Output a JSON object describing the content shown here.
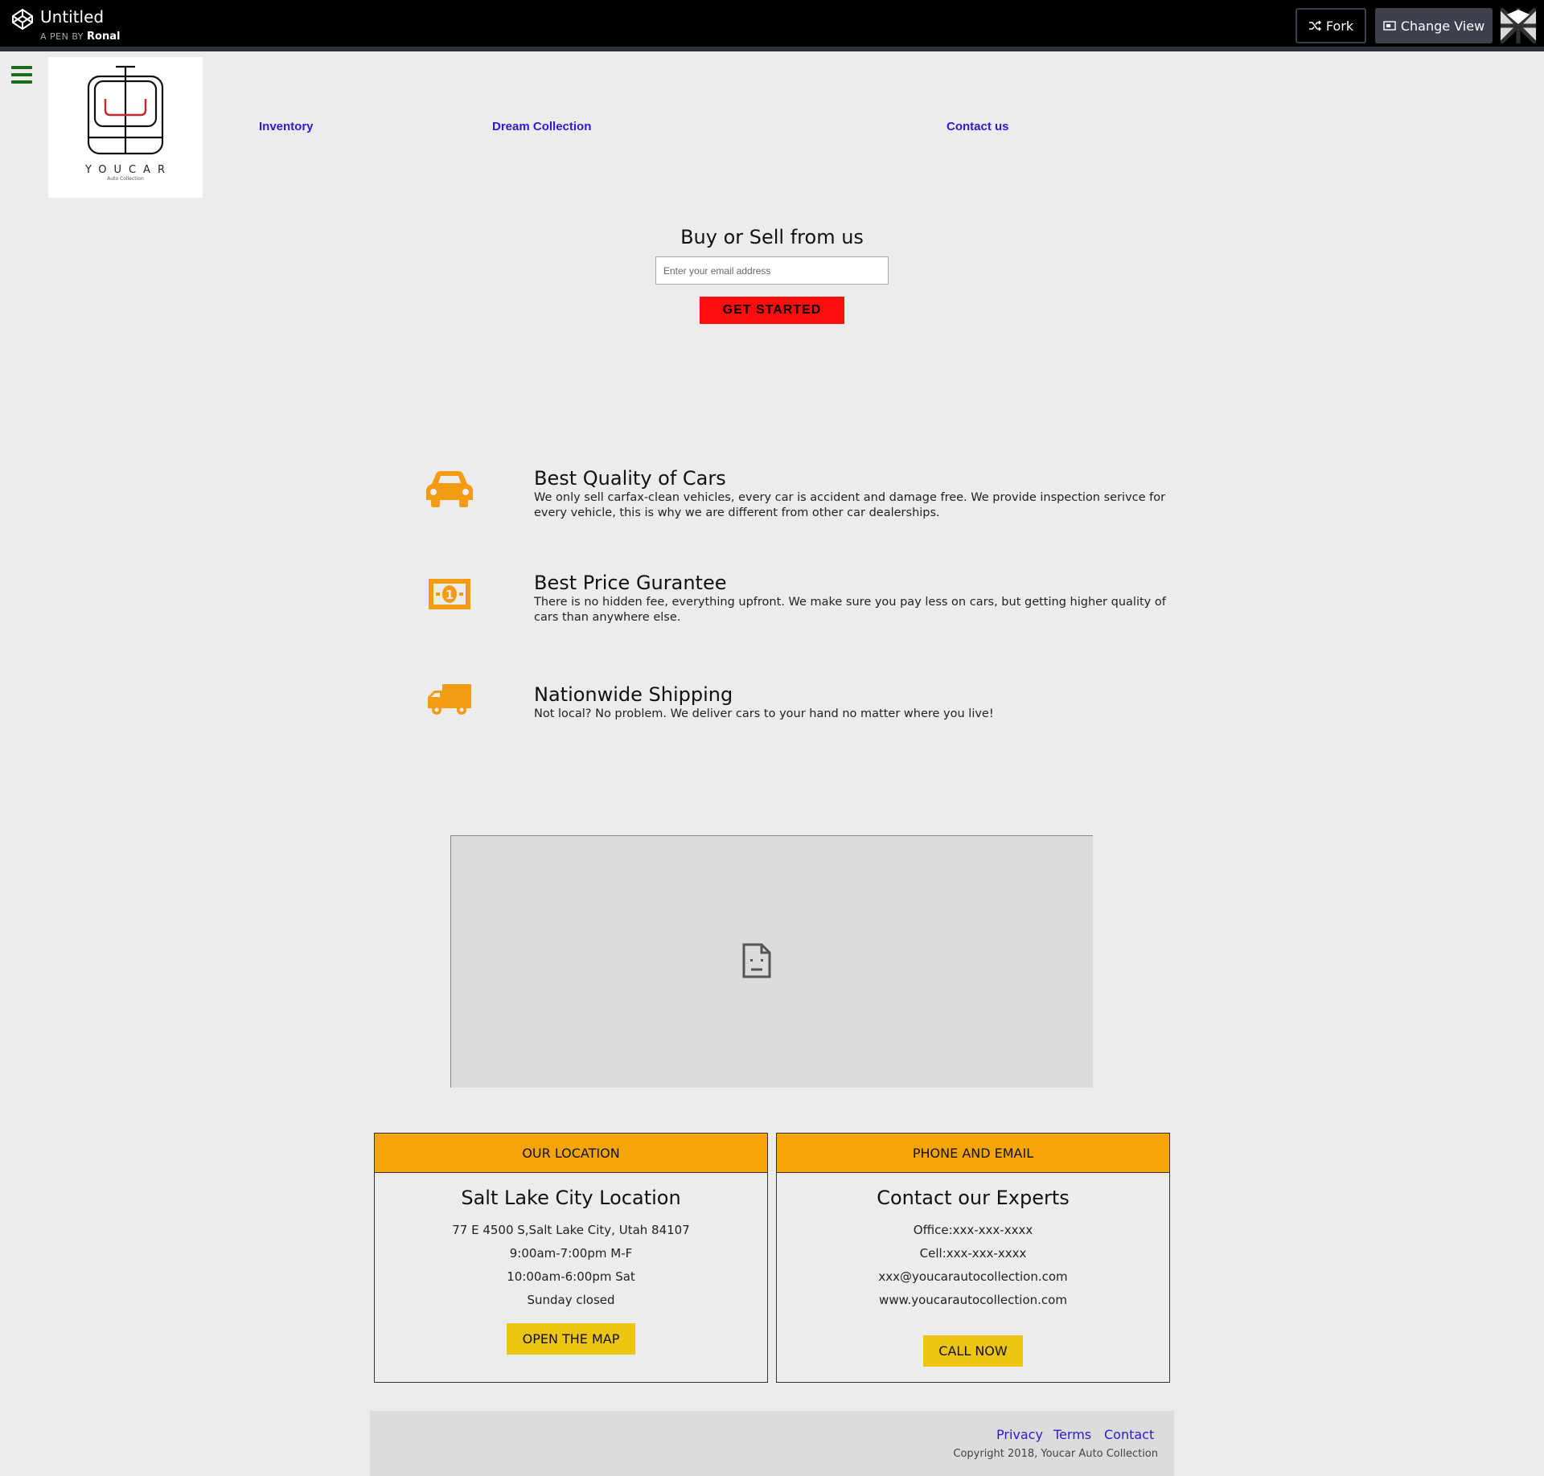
{
  "codepen": {
    "title": "Untitled",
    "byline_prefix": "A PEN BY",
    "author": "Ronal",
    "fork_label": "Fork",
    "change_view_label": "Change View"
  },
  "brand": {
    "name": "YOUCAR",
    "tagline": "Auto Collection",
    "accent_color": "#c0282d"
  },
  "nav": {
    "items": [
      {
        "label": "Inventory"
      },
      {
        "label": "Dream Collection"
      },
      {
        "label": "Contact us"
      }
    ],
    "link_color": "#2a1bd0"
  },
  "hero": {
    "title": "Buy or Sell from us",
    "email_placeholder": "Enter your email address",
    "cta_label": "GET STARTED",
    "cta_color": "#ff0d0d"
  },
  "features": [
    {
      "icon": "car-icon",
      "title": "Best Quality of Cars",
      "text": "We only sell carfax-clean vehicles, every car is accident and damage free. We provide inspection serivce for every vehicle, this is why we are different from other car dealerships."
    },
    {
      "icon": "money-icon",
      "title": "Best Price Gurantee",
      "text": "There is no hidden fee, everything upfront. We make sure you pay less on cars, but getting higher quality of cars than anywhere else."
    },
    {
      "icon": "truck-icon",
      "title": "Nationwide Shipping",
      "text": "Not local? No problem. We deliver cars to your hand no matter where you live!"
    }
  ],
  "feature_icon_color": "#f39c12",
  "location_card": {
    "header": "OUR LOCATION",
    "title": "Salt Lake City Location",
    "lines": [
      "77 E 4500 S,Salt Lake City, Utah 84107",
      "9:00am-7:00pm M-F",
      "10:00am-6:00pm Sat",
      "Sunday closed"
    ],
    "button": "OPEN THE MAP"
  },
  "contact_card": {
    "header": "PHONE AND EMAIL",
    "title": "Contact our Experts",
    "lines": [
      "Office:xxx-xxx-xxxx",
      "Cell:xxx-xxx-xxxx",
      "xxx@youcarautocollection.com",
      "www.youcarautocollection.com"
    ],
    "button": "CALL NOW"
  },
  "card_header_color": "#f5a50a",
  "card_button_color": "#ecc412",
  "footer": {
    "links": [
      "Privacy",
      "Terms",
      "Contact"
    ],
    "copyright": "Copyright 2018, Youcar Auto Collection"
  }
}
